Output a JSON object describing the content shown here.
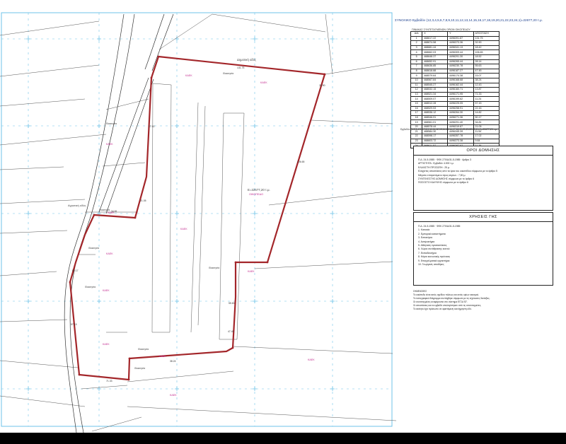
{
  "sheet": {
    "title": "ΣΥΝΟΛΙΚΟ Εμβαδόν (12,3,4,5,6,7,8,9,10,11,12,13,14,15,16,17,18,19,20,21,22,23,24,1)=22677,20 τ.μ."
  },
  "coordinates": {
    "caption": "ΠΙΝΑΚΑΣ ΣΥΝΤΕΤΑΓΜΕΝΩΝ ΟΡΙΩΝ ΟΙΚΟΠΕΔΟΥ",
    "columns": [
      "Α/Α",
      "X",
      "Y",
      "ΑΠΟΣΤΑΣΗ"
    ],
    "rows": [
      [
        "1",
        "468617.22",
        "4496391.87",
        "131.75"
      ],
      [
        "2",
        "468674.58",
        "4496373.36",
        "32.90"
      ],
      [
        "3",
        "468681.44",
        "4496341.13",
        "18.42"
      ],
      [
        "4",
        "468662.03",
        "4496309.44",
        "106.65"
      ],
      [
        "5",
        "468648.37",
        "4496291.30",
        "18.52"
      ],
      [
        "6",
        "468652.91",
        "4496265.44",
        "28.14"
      ],
      [
        "7",
        "468636.85",
        "4496230.78",
        "55.63"
      ],
      [
        "8",
        "468618.88",
        "4496187.27",
        "47.45"
      ],
      [
        "9",
        "468579.64",
        "4496174.38",
        "15.07"
      ],
      [
        "10",
        "468567.84",
        "4496168.68",
        "38.24"
      ],
      [
        "11",
        "468545.27",
        "4496162.44",
        "12.43"
      ],
      [
        "12",
        "468532.15",
        "4496160.71",
        "13.87"
      ],
      [
        "13",
        "468521.34",
        "4496171.95",
        "71.33"
      ],
      [
        "14",
        "468509.07",
        "4496199.62",
        "11.24"
      ],
      [
        "15",
        "468512.28",
        "4496225.05",
        "57.15"
      ],
      [
        "16",
        "468529.53",
        "4496258.91",
        "22.16"
      ],
      [
        "17",
        "468536.12",
        "4496264.30",
        "14.82"
      ],
      [
        "18",
        "468546.91",
        "4496271.36",
        "50.17"
      ],
      [
        "19",
        "468561.01",
        "4496291.40",
        "34.81"
      ],
      [
        "20",
        "468578.44",
        "4496319.87",
        "21.05"
      ],
      [
        "21",
        "468584.30",
        "4496345.39",
        "11.54"
      ],
      [
        "22",
        "468598.17",
        "4496357.78",
        "17.02"
      ],
      [
        "23",
        "468603.72",
        "4496373.38",
        "9.84"
      ],
      [
        "24",
        "468611.57",
        "4496387.02",
        "11.39"
      ]
    ],
    "footer": "Εμβαδόν (1,2,3,4,5,6,7,8,9,10,11,12,13,14,15,16,17,18,19,20,21,22,23,24,1)=22677,20 τ.μ."
  },
  "building_rules": {
    "heading": "ΟΡΟΙ ΔΟΜΗΣΗΣ",
    "lines": [
      "Π.Δ. 24-5-1985 · ΦΕΚ 270/Δ/31-5-1985 · Αρθρο 3",
      "ΑΡΤΙΟΤΗΤΑ :  Εμβαδόν  4.000 τ.μ.",
      "ΕΛΑΧΙΣΤΗ ΠΡΟΣΩΠΗ :  25 μ.",
      "Ελάχιστες αποστάσεις από τα όρια του οικοπέδου σύμφωνα με το άρθρο 5",
      "Μέγιστο επιτρεπόμενο ύψος κτιρίων :  7,50 μ.",
      "ΣΥΝΤΕΛΕΣΤΗΣ ΔΟΜΗΣΗΣ σύμφωνα με το άρθρο 6",
      "ΠΟΣΟΣΤΟ ΚΑΛΥΨΗΣ σύμφωνα με το άρθρο 6"
    ]
  },
  "land_use": {
    "heading": "ΧΡΗΣΕΙΣ ΓΗΣ",
    "lines": [
      "Π.Δ. 24-5-1985 · ΦΕΚ 270/Δ/31-5-1985",
      "1. Κατοικία",
      "2. Εμπορικά καταστήματα",
      "3. Εστιατόρια",
      "4. Αναψυκτήρια",
      "5. Αθλητικές εγκαταστάσεις",
      "6. Χώροι συνάθροισης κοινού",
      "7. Εκπαιδευτήρια",
      "8. Κτίρια κοινωνικής πρόνοιας",
      "9. Επαγγελματικά εργαστήρια",
      "10. Γεωργικές αποθήκες"
    ]
  },
  "notes": {
    "lines": [
      "ΣΗΜΕΙΩΣΕΙΣ",
      "Το οικόπεδο είναι εκτός σχεδίου πόλεως και εκτός ορίων οικισμού.",
      "Το τοπογραφικό διάγραμμα συντάχθηκε σύμφωνα με τις ισχύουσες διατάξεις.",
      "Οι συντεταγμένες αναφέρονται στο σύστημα ΕΓΣΑ '87.",
      "Οι αποστάσεις και τα εμβαδά υπολογίστηκαν από τις συντεταγμένες.",
      "Το ακίνητο έχει πρόσωπο σε υφιστάμενη κοινόχρηστη οδό."
    ]
  },
  "plan": {
    "road_label_top": "Δημοτική οδός",
    "road_label_left": "Αγροτική οδός",
    "parcel_area_label": "E=22677,20 τ.μ.",
    "block_code": "ΟΙΚΟΠΕΔΟ",
    "neighbor_codes": [
      "ΚΑΕΚ",
      "ΚΑΕΚ",
      "ΚΑΕΚ",
      "ΚΑΕΚ",
      "ΚΑΕΚ",
      "ΚΑΕΚ",
      "ΚΑΕΚ",
      "ΚΑΕΚ",
      "ΚΑΕΚ",
      "ΚΑΕΚ",
      "ΚΑΕΚ",
      "ΚΑΕΚ"
    ],
    "neighbor_owners": [
      "Ιδιοκτησία",
      "Ιδιοκτησία",
      "Ιδιοκτησία",
      "Ιδιοκτησία",
      "Ιδιοκτησία",
      "Ιδιοκτησία",
      "Ιδιοκτησία",
      "Ιδιοκτησία"
    ],
    "boundary_lengths": [
      "131.75",
      "32.90",
      "106.65",
      "55.63",
      "47.45",
      "38.24",
      "71.33",
      "57.15",
      "50.17",
      "34.81",
      "21.05",
      "17.02"
    ],
    "colors": {
      "parcel_boundary": "#a3262a",
      "grid": "#6fc3e8",
      "code_text": "#c12a8e",
      "title_text": "#1a3e8c"
    }
  }
}
